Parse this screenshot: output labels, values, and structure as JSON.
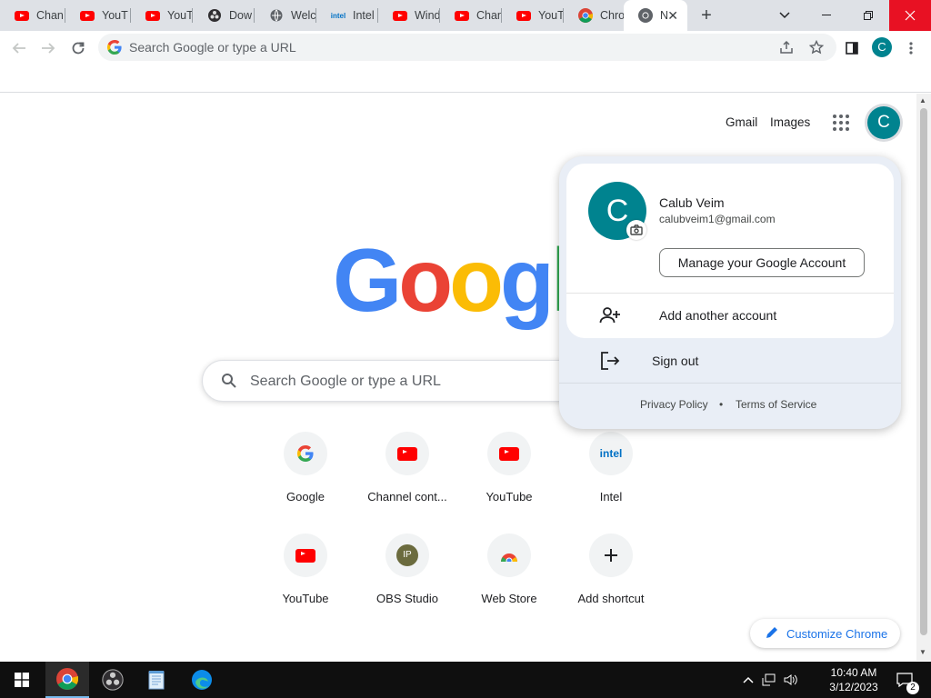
{
  "tabs": [
    {
      "title": "Chan",
      "icon": "youtube-icon"
    },
    {
      "title": "YouT",
      "icon": "youtube-icon"
    },
    {
      "title": "YouT",
      "icon": "youtube-icon"
    },
    {
      "title": "Dow",
      "icon": "obs-icon"
    },
    {
      "title": "Welc",
      "icon": "globe-icon"
    },
    {
      "title": "Intel",
      "icon": "intel-icon"
    },
    {
      "title": "Wind",
      "icon": "youtube-icon"
    },
    {
      "title": "Chan",
      "icon": "youtube-icon"
    },
    {
      "title": "YouT",
      "icon": "youtube-icon"
    },
    {
      "title": "Chro",
      "icon": "chrome-icon"
    },
    {
      "title": "N",
      "icon": "chrome-icon",
      "active": true
    }
  ],
  "omnibox": {
    "placeholder": "Search Google or type a URL"
  },
  "header": {
    "gmail": "Gmail",
    "images": "Images",
    "avatar_letter": "C"
  },
  "logo": {
    "text": "Google",
    "colors": [
      "#4285F4",
      "#EA4335",
      "#FBBC05",
      "#4285F4",
      "#34A853",
      "#EA4335"
    ]
  },
  "search": {
    "placeholder": "Search Google or type a URL"
  },
  "shortcuts": [
    {
      "label": "Google",
      "icon": "google-icon"
    },
    {
      "label": "Channel cont...",
      "icon": "youtube-icon"
    },
    {
      "label": "YouTube",
      "icon": "youtube-icon"
    },
    {
      "label": "Intel",
      "icon": "intel-icon"
    },
    {
      "label": "YouTube",
      "icon": "youtube-icon"
    },
    {
      "label": "OBS Studio",
      "icon": "obs-ip-icon"
    },
    {
      "label": "Web Store",
      "icon": "chrome-web-store-icon"
    },
    {
      "label": "Add shortcut",
      "icon": "plus-icon"
    }
  ],
  "customize": {
    "label": "Customize Chrome"
  },
  "account_popup": {
    "name": "Calub Veim",
    "email": "calubveim1@gmail.com",
    "avatar_letter": "C",
    "manage_label": "Manage your Google Account",
    "add_account_label": "Add another account",
    "sign_out_label": "Sign out",
    "privacy_label": "Privacy Policy",
    "bullet": "•",
    "terms_label": "Terms of Service"
  },
  "taskbar": {
    "time": "10:40 AM",
    "date": "3/12/2023",
    "notification_count": "2",
    "apps": [
      "windows-start-icon",
      "chrome-icon",
      "obs-icon",
      "notepad-icon",
      "edge-icon"
    ]
  },
  "colors": {
    "accent": "#1a73e8",
    "avatar": "#00838f",
    "popup_bg": "#e9eef6",
    "close_red": "#e81123"
  }
}
